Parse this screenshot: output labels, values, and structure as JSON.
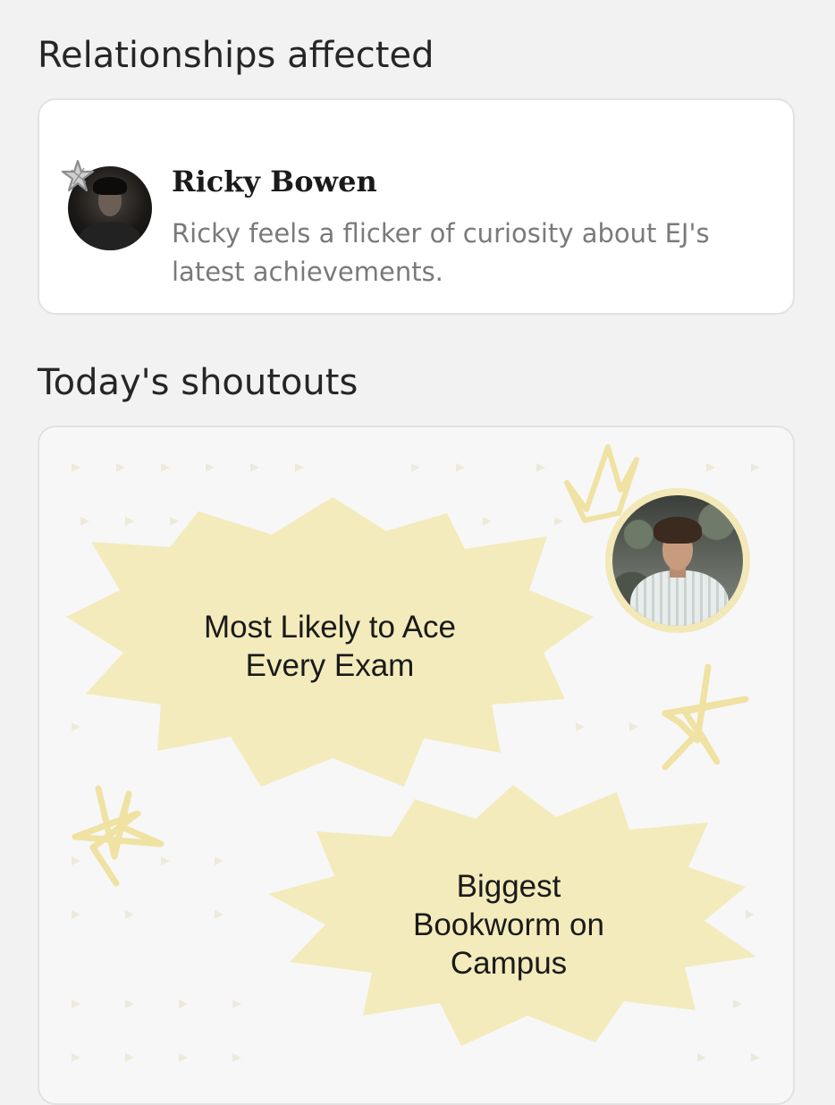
{
  "relationships": {
    "title": "Relationships affected",
    "items": [
      {
        "name": "Ricky Bowen",
        "description": "Ricky feels a flicker of curiosity about EJ's latest achievements.",
        "avatar_icon": "person-avatar",
        "badge_icon": "star-icon"
      }
    ]
  },
  "shoutouts": {
    "title": "Today's shoutouts",
    "items": [
      {
        "label": "Most Likely to Ace Every Exam"
      },
      {
        "label": "Biggest Bookworm on Campus"
      }
    ],
    "accent_color": "#f3ebbb",
    "doodle_color": "#efe2a2",
    "decor_icons": [
      "crown-icon",
      "star-icon",
      "star-icon"
    ]
  },
  "colors": {
    "background": "#f2f2f2",
    "card": "#ffffff",
    "card_border": "#e2e2e2",
    "muted_text": "#7a7a7a"
  }
}
